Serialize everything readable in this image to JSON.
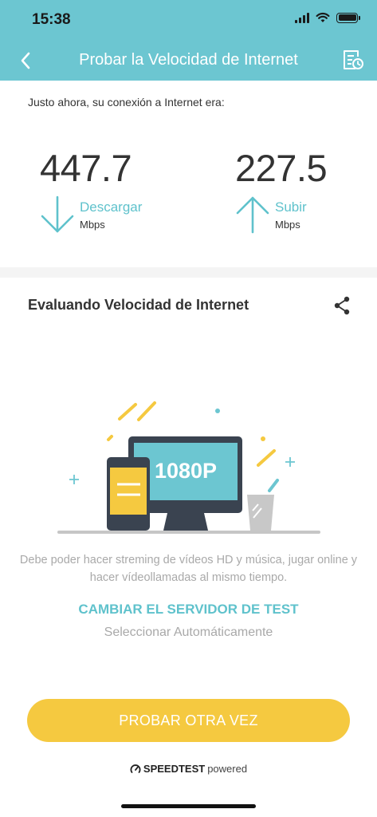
{
  "status_bar": {
    "time": "15:38"
  },
  "header": {
    "title": "Probar la Velocidad de Internet",
    "back_icon": "chevron-left-icon",
    "history_icon": "history-report-icon"
  },
  "results": {
    "intro": "Justo ahora, su conexión a Internet era:",
    "download": {
      "value": "447.7",
      "label": "Descargar",
      "unit": "Mbps",
      "icon": "arrow-down-icon"
    },
    "upload": {
      "value": "227.5",
      "label": "Subir",
      "unit": "Mbps",
      "icon": "arrow-up-icon"
    }
  },
  "evaluation": {
    "title": "Evaluando Velocidad de Internet",
    "share_icon": "share-icon",
    "illustration_text": "1080P",
    "description": "Debe poder hacer streming de vídeos HD y música, jugar online y hacer vídeollamadas al mismo tiempo.",
    "server_link": "CAMBIAR EL SERVIDOR DE TEST",
    "server_value": "Seleccionar Automáticamente"
  },
  "actions": {
    "retry_label": "PROBAR OTRA VEZ"
  },
  "footer": {
    "brand": "SPEEDTEST",
    "suffix": "powered",
    "icon": "speedtest-gauge-icon"
  },
  "colors": {
    "header": "#6cc6d1",
    "accent": "#5fc2cc",
    "button": "#f5c940"
  }
}
